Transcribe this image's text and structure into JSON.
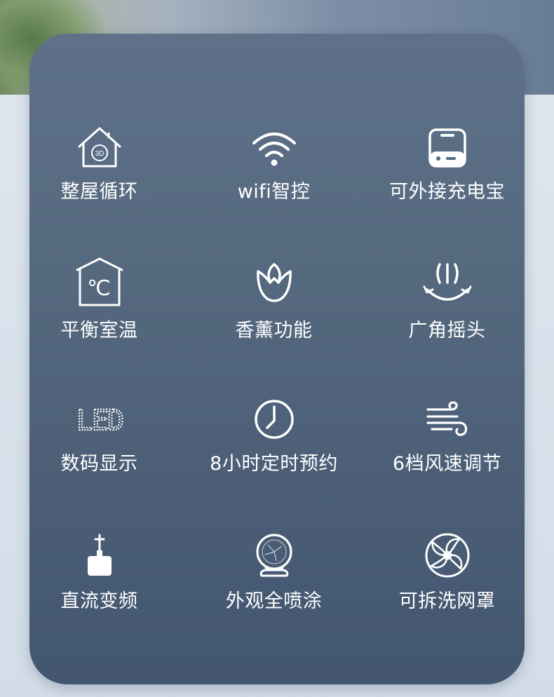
{
  "features": [
    {
      "label": "整屋循环",
      "icon": "house-3d-icon",
      "house_badge": "3D"
    },
    {
      "label": "wifi智控",
      "icon": "wifi-icon"
    },
    {
      "label": "可外接充电宝",
      "icon": "power-bank-icon"
    },
    {
      "label": "平衡室温",
      "icon": "room-temperature-icon",
      "temp_symbol": "℃"
    },
    {
      "label": "香薰功能",
      "icon": "aroma-flower-icon"
    },
    {
      "label": "广角摇头",
      "icon": "wide-angle-oscillation-icon"
    },
    {
      "label": "数码显示",
      "icon": "led-display-icon",
      "led_text": "LED"
    },
    {
      "label": "8小时定时预约",
      "icon": "clock-icon"
    },
    {
      "label": "6档风速调节",
      "icon": "wind-icon"
    },
    {
      "label": "直流变频",
      "icon": "dc-battery-icon"
    },
    {
      "label": "外观全喷涂",
      "icon": "fan-body-icon"
    },
    {
      "label": "可拆洗网罩",
      "icon": "fan-grille-icon"
    }
  ],
  "colors": {
    "panel": "#55697f",
    "text": "#ffffff"
  }
}
